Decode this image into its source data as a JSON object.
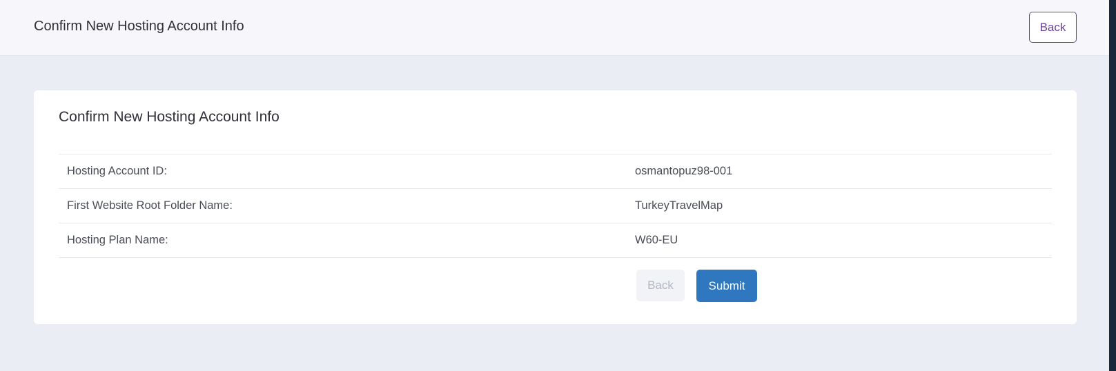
{
  "header": {
    "title": "Confirm New Hosting Account Info",
    "back_label": "Back"
  },
  "card": {
    "title": "Confirm New Hosting Account Info",
    "rows": [
      {
        "label": "Hosting Account ID:",
        "value": "osmantopuz98-001"
      },
      {
        "label": "First Website Root Folder Name:",
        "value": "TurkeyTravelMap"
      },
      {
        "label": "Hosting Plan Name:",
        "value": "W60-EU"
      }
    ],
    "actions": {
      "back_label": "Back",
      "submit_label": "Submit"
    }
  },
  "colors": {
    "accent_purple": "#6a3f9a",
    "submit_blue": "#2f78bf",
    "background": "#ebedf5"
  }
}
